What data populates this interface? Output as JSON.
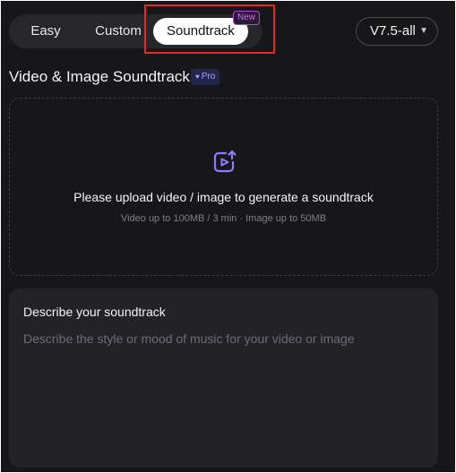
{
  "tabs": {
    "easy": "Easy",
    "custom": "Custom",
    "soundtrack": "Soundtrack",
    "active": "soundtrack"
  },
  "new_badge": "New",
  "version": {
    "selected": "V7.5-all"
  },
  "section": {
    "title": "Video & Image Soundtrack",
    "badge": "Pro"
  },
  "upload": {
    "icon": "upload-media-icon",
    "title": "Please upload video / image to generate a soundtrack",
    "hint": "Video up to 100MB / 3 min · Image up to 50MB"
  },
  "describe": {
    "label": "Describe your soundtrack",
    "placeholder": "Describe the style or mood of music for your video or image",
    "value": ""
  },
  "colors": {
    "background": "#17171a",
    "accent_purple": "#8b7cff",
    "new_badge": "#d46bff",
    "highlight": "#e32b25"
  }
}
